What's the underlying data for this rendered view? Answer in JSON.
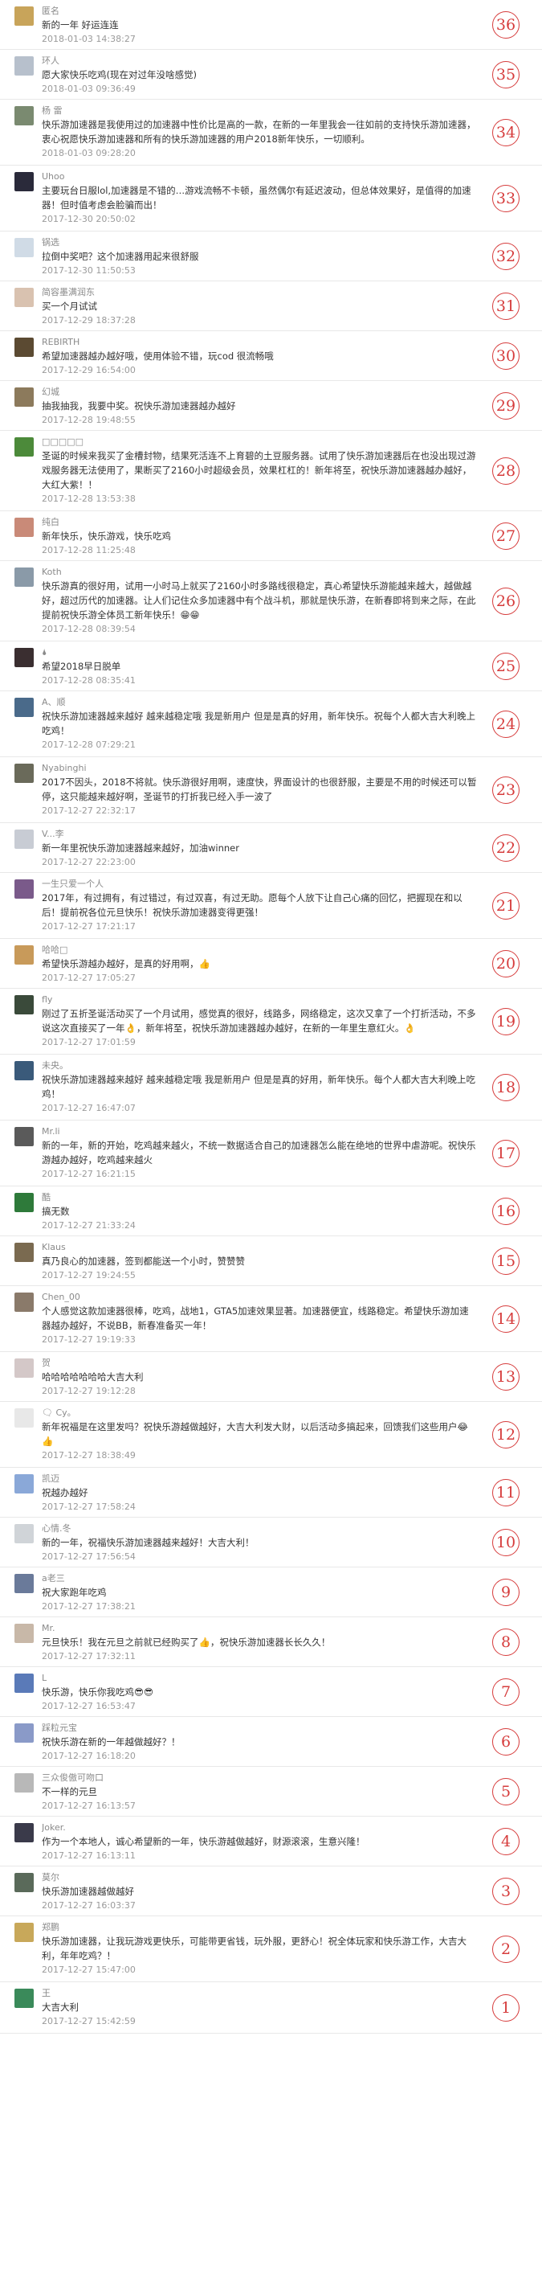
{
  "colors": {
    "floor_accent": "#d63c3c",
    "divider": "#e8e8e8",
    "nick": "#8a8a8a",
    "time": "#9a9a9a"
  },
  "comments": [
    {
      "nick": "匿名",
      "text": "新的一年 好运连连",
      "time": "2018-01-03 14:38:27",
      "floor": "36",
      "avatar": "#c8a45a"
    },
    {
      "nick": "环人",
      "text": "愿大家快乐吃鸡(现在对过年没啥感觉)",
      "time": "2018-01-03 09:36:49",
      "floor": "35",
      "avatar": "#b7c0cc"
    },
    {
      "nick": "杨 雷",
      "text": "快乐游加速器是我使用过的加速器中性价比是高的一款，在新的一年里我会一往如前的支持快乐游加速器，衷心祝愿快乐游加速器和所有的快乐游加速器的用户2018新年快乐，一切顺利。",
      "time": "2018-01-03 09:28:20",
      "floor": "34",
      "avatar": "#7a8a70"
    },
    {
      "nick": "Uhoo",
      "text": "主要玩台日服lol,加速器是不错的…游戏流畅不卡顿，虽然偶尔有延迟波动，但总体效果好，是值得的加速器！但时值考虑会脸骗而出！",
      "time": "2017-12-30 20:50:02",
      "floor": "33",
      "avatar": "#2a2a3a"
    },
    {
      "nick": "锅选",
      "text": "拉倒中奖吧？这个加速器用起来很舒服",
      "time": "2017-12-30 11:50:53",
      "floor": "32",
      "avatar": "#d0dbe6"
    },
    {
      "nick": "简容墨满润东",
      "text": "买一个月试试",
      "time": "2017-12-29 18:37:28",
      "floor": "31",
      "avatar": "#d9c2b0"
    },
    {
      "nick": "REBIRTH",
      "text": "希望加速器越办越好哦，使用体验不错，玩cod 很流畅哦",
      "time": "2017-12-29 16:54:00",
      "floor": "30",
      "avatar": "#5b4a32"
    },
    {
      "nick": "幻城",
      "text": "抽我抽我，我要中奖。祝快乐游加速器越办越好",
      "time": "2017-12-28 19:48:55",
      "floor": "29",
      "avatar": "#8c7a5c"
    },
    {
      "nick": "□□□□□",
      "text": "圣诞的时候来我买了金槽封物，结果死活连不上育碧的土豆服务器。试用了快乐游加速器后在也没出现过游戏服务器无法使用了，果断买了2160小时超级会员，效果杠杠的！新年将至，祝快乐游加速器越办越好，大红大紫！！",
      "time": "2017-12-28 13:53:38",
      "floor": "28",
      "avatar": "#4c8a3a"
    },
    {
      "nick": "纯白",
      "text": "新年快乐，快乐游戏，快乐吃鸡",
      "time": "2017-12-28 11:25:48",
      "floor": "27",
      "avatar": "#c98a78"
    },
    {
      "nick": "Koth",
      "text": "快乐游真的很好用，试用一小时马上就买了2160小时多路线很稳定，真心希望快乐游能越来越大，越做越好，超过历代的加速器。让人们记住众多加速器中有个战斗机，那就是快乐游，在新春即将到来之际，在此提前祝快乐游全体员工新年快乐！😁😁",
      "time": "2017-12-28 08:39:54",
      "floor": "26",
      "avatar": "#8a9aa8"
    },
    {
      "nick": "🌢",
      "text": "希望2018早日脱单",
      "time": "2017-12-28 08:35:41",
      "floor": "25",
      "avatar": "#3a2e30"
    },
    {
      "nick": "A、顺",
      "text": "祝快乐游加速器越来越好 越来越稳定哦 我是新用户 但是是真的好用，新年快乐。祝每个人都大吉大利晚上吃鸡！",
      "time": "2017-12-28 07:29:21",
      "floor": "24",
      "avatar": "#4a6a8a"
    },
    {
      "nick": "Nyabinghi",
      "text": "2017不因头，2018不将就。快乐游很好用啊，速度快，界面设计的也很舒服，主要是不用的时候还可以暂停，这只能越来越好啊，圣诞节的打折我已经入手一波了",
      "time": "2017-12-27 22:32:17",
      "floor": "23",
      "avatar": "#6a6a5a"
    },
    {
      "nick": "V...李",
      "text": "新一年里祝快乐游加速器越来越好，加油winner",
      "time": "2017-12-27 22:23:00",
      "floor": "22",
      "avatar": "#c8ccd4"
    },
    {
      "nick": "一生只爱一个人",
      "text": "2017年，有过拥有，有过错过，有过双喜，有过无助。愿每个人放下让自己心痛的回忆，把握现在和以后！提前祝各位元旦快乐！祝快乐游加速器变得更强！",
      "time": "2017-12-27 17:21:17",
      "floor": "21",
      "avatar": "#7a5a8a"
    },
    {
      "nick": "哈哈□",
      "text": "希望快乐游越办越好，是真的好用啊，👍",
      "time": "2017-12-27 17:05:27",
      "floor": "20",
      "avatar": "#c89a5a"
    },
    {
      "nick": "fly",
      "text": "刚过了五折圣诞活动买了一个月试用，感觉真的很好，线路多，网络稳定，这次又拿了一个打折活动，不多说这次直接买了一年👌，新年将至，祝快乐游加速器越办越好，在新的一年里生意红火。👌",
      "time": "2017-12-27 17:01:59",
      "floor": "19",
      "avatar": "#3a4a3a"
    },
    {
      "nick": "未央。",
      "text": "祝快乐游加速器越来越好 越来越稳定哦 我是新用户 但是是真的好用，新年快乐。每个人都大吉大利晚上吃鸡！",
      "time": "2017-12-27 16:47:07",
      "floor": "18",
      "avatar": "#3a5a7a"
    },
    {
      "nick": "Mr.li",
      "text": "新的一年，新的开始，吃鸡越来越火，不统一数据适合自己的加速器怎么能在绝地的世界中虐游呢。祝快乐游越办越好，吃鸡越来越火",
      "time": "2017-12-27 16:21:15",
      "floor": "17",
      "avatar": "#5a5a5a"
    },
    {
      "nick": "酷",
      "text": "搞无数",
      "time": "2017-12-27 21:33:24",
      "floor": "16",
      "avatar": "#2e7a3a"
    },
    {
      "nick": "Klaus",
      "text": "真乃良心的加速器，签到都能送一个小时，赞赞赞",
      "time": "2017-12-27 19:24:55",
      "floor": "15",
      "avatar": "#7a6a50"
    },
    {
      "nick": "Chen_00",
      "text": "个人感觉这款加速器很棒，吃鸡，战地1，GTA5加速效果显著。加速器便宜，线路稳定。希望快乐游加速器越办越好，不说BB，新春准备买一年！",
      "time": "2017-12-27 19:19:33",
      "floor": "14",
      "avatar": "#8a7a6a"
    },
    {
      "nick": "贺",
      "text": "哈哈哈哈哈哈哈大吉大利",
      "time": "2017-12-27 19:12:28",
      "floor": "13",
      "avatar": "#d4c8c8"
    },
    {
      "nick": "🗨 Cy。",
      "text": "新年祝福是在这里发吗？祝快乐游越做越好，大吉大利发大财，以后活动多搞起来，回馈我们这些用户😂👍",
      "time": "2017-12-27 18:38:49",
      "floor": "12",
      "avatar": "#e8e8e8"
    },
    {
      "nick": "凯迈",
      "text": "祝越办越好",
      "time": "2017-12-27 17:58:24",
      "floor": "11",
      "avatar": "#8aa8d8"
    },
    {
      "nick": "心情.冬",
      "text": "新的一年，祝福快乐游加速器越来越好！大吉大利！",
      "time": "2017-12-27 17:56:54",
      "floor": "10",
      "avatar": "#d0d4d8"
    },
    {
      "nick": "a老三",
      "text": "祝大家跑年吃鸡",
      "time": "2017-12-27 17:38:21",
      "floor": "9",
      "avatar": "#6a7a9a"
    },
    {
      "nick": "Mr.",
      "text": "元旦快乐！我在元旦之前就已经购买了👍，祝快乐游加速器长长久久！",
      "time": "2017-12-27 17:32:11",
      "floor": "8",
      "avatar": "#c8b8a8"
    },
    {
      "nick": "L",
      "text": "快乐游，快乐你我吃鸡😎😎",
      "time": "2017-12-27 16:53:47",
      "floor": "7",
      "avatar": "#5a7ab8"
    },
    {
      "nick": "踩粒元宝",
      "text": "祝快乐游在新的一年越做越好？！",
      "time": "2017-12-27 16:18:20",
      "floor": "6",
      "avatar": "#8a9ac8"
    },
    {
      "nick": "三众俊傲可吻口",
      "text": "不一样的元旦",
      "time": "2017-12-27 16:13:57",
      "floor": "5",
      "avatar": "#b8b8b8"
    },
    {
      "nick": "Joker.",
      "text": "作为一个本地人，诚心希望新的一年，快乐游越做越好，财源滚滚，生意兴隆！",
      "time": "2017-12-27 16:13:11",
      "floor": "4",
      "avatar": "#3a3a4a"
    },
    {
      "nick": "莫尔",
      "text": "快乐游加速器越做越好",
      "time": "2017-12-27 16:03:37",
      "floor": "3",
      "avatar": "#5a6a5a"
    },
    {
      "nick": "郑鹏",
      "text": "快乐游加速器，让我玩游戏更快乐，可能带更省钱，玩外服，更舒心！祝全体玩家和快乐游工作，大吉大利，年年吃鸡？！",
      "time": "2017-12-27 15:47:00",
      "floor": "2",
      "avatar": "#c8a85a"
    },
    {
      "nick": "王",
      "text": "大吉大利",
      "time": "2017-12-27 15:42:59",
      "floor": "1",
      "avatar": "#3a8a5a"
    }
  ]
}
